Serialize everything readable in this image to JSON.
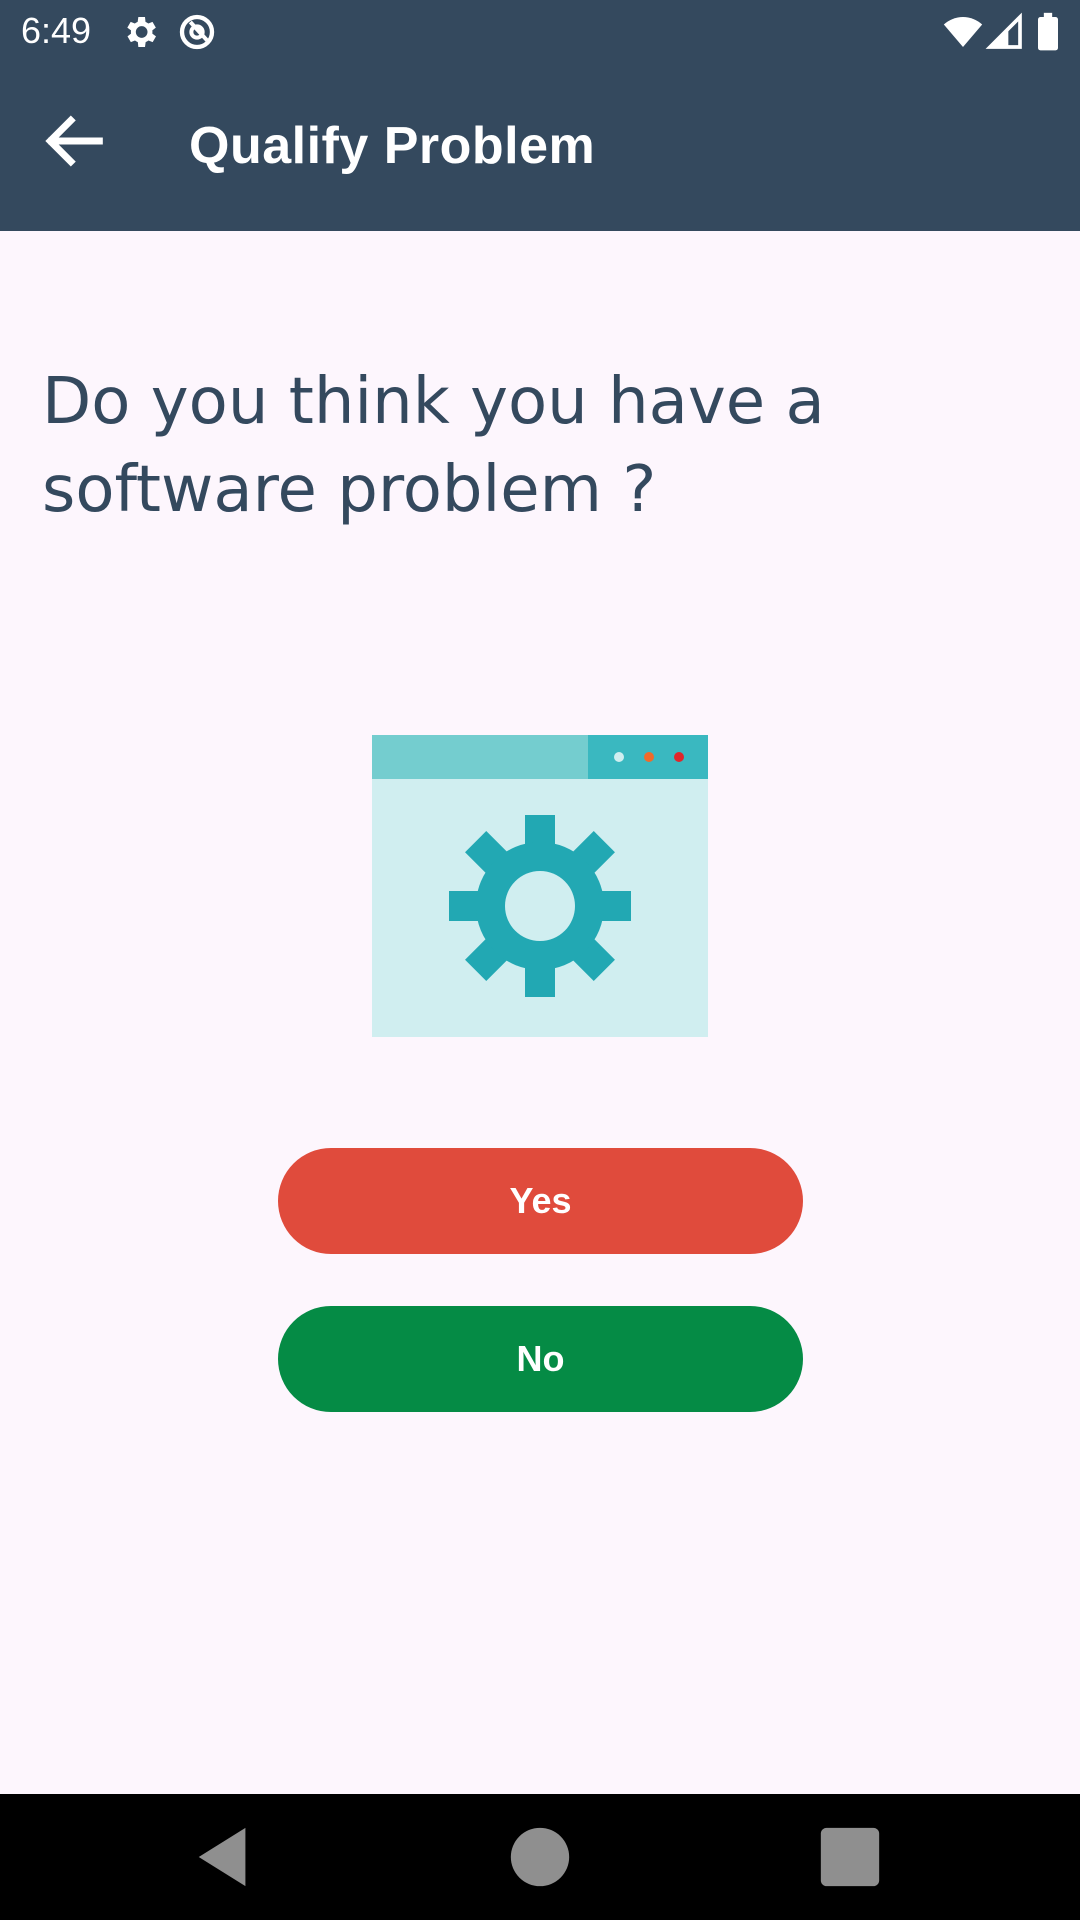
{
  "status_bar": {
    "time": "6:49",
    "icons": [
      "settings-icon",
      "at-sign-icon",
      "wifi-icon",
      "signal-icon",
      "battery-icon"
    ]
  },
  "app_bar": {
    "title": "Qualify Problem",
    "back_icon": "arrow-left-icon"
  },
  "question": {
    "text": "Do you think you have a software problem ?"
  },
  "illustration": {
    "icon": "software-settings-window-icon"
  },
  "buttons": {
    "yes_label": "Yes",
    "no_label": "No"
  },
  "nav_bar": {
    "icons": [
      "back-triangle-icon",
      "home-circle-icon",
      "recents-square-icon"
    ]
  },
  "colors": {
    "app_bar": "#34495e",
    "background": "#fdf6fd",
    "question_text": "#34495e",
    "yes_button": "#e04b3c",
    "no_button": "#058b45",
    "illustration_accent": "#22a8b3",
    "illustration_light": "#d0eef0"
  }
}
